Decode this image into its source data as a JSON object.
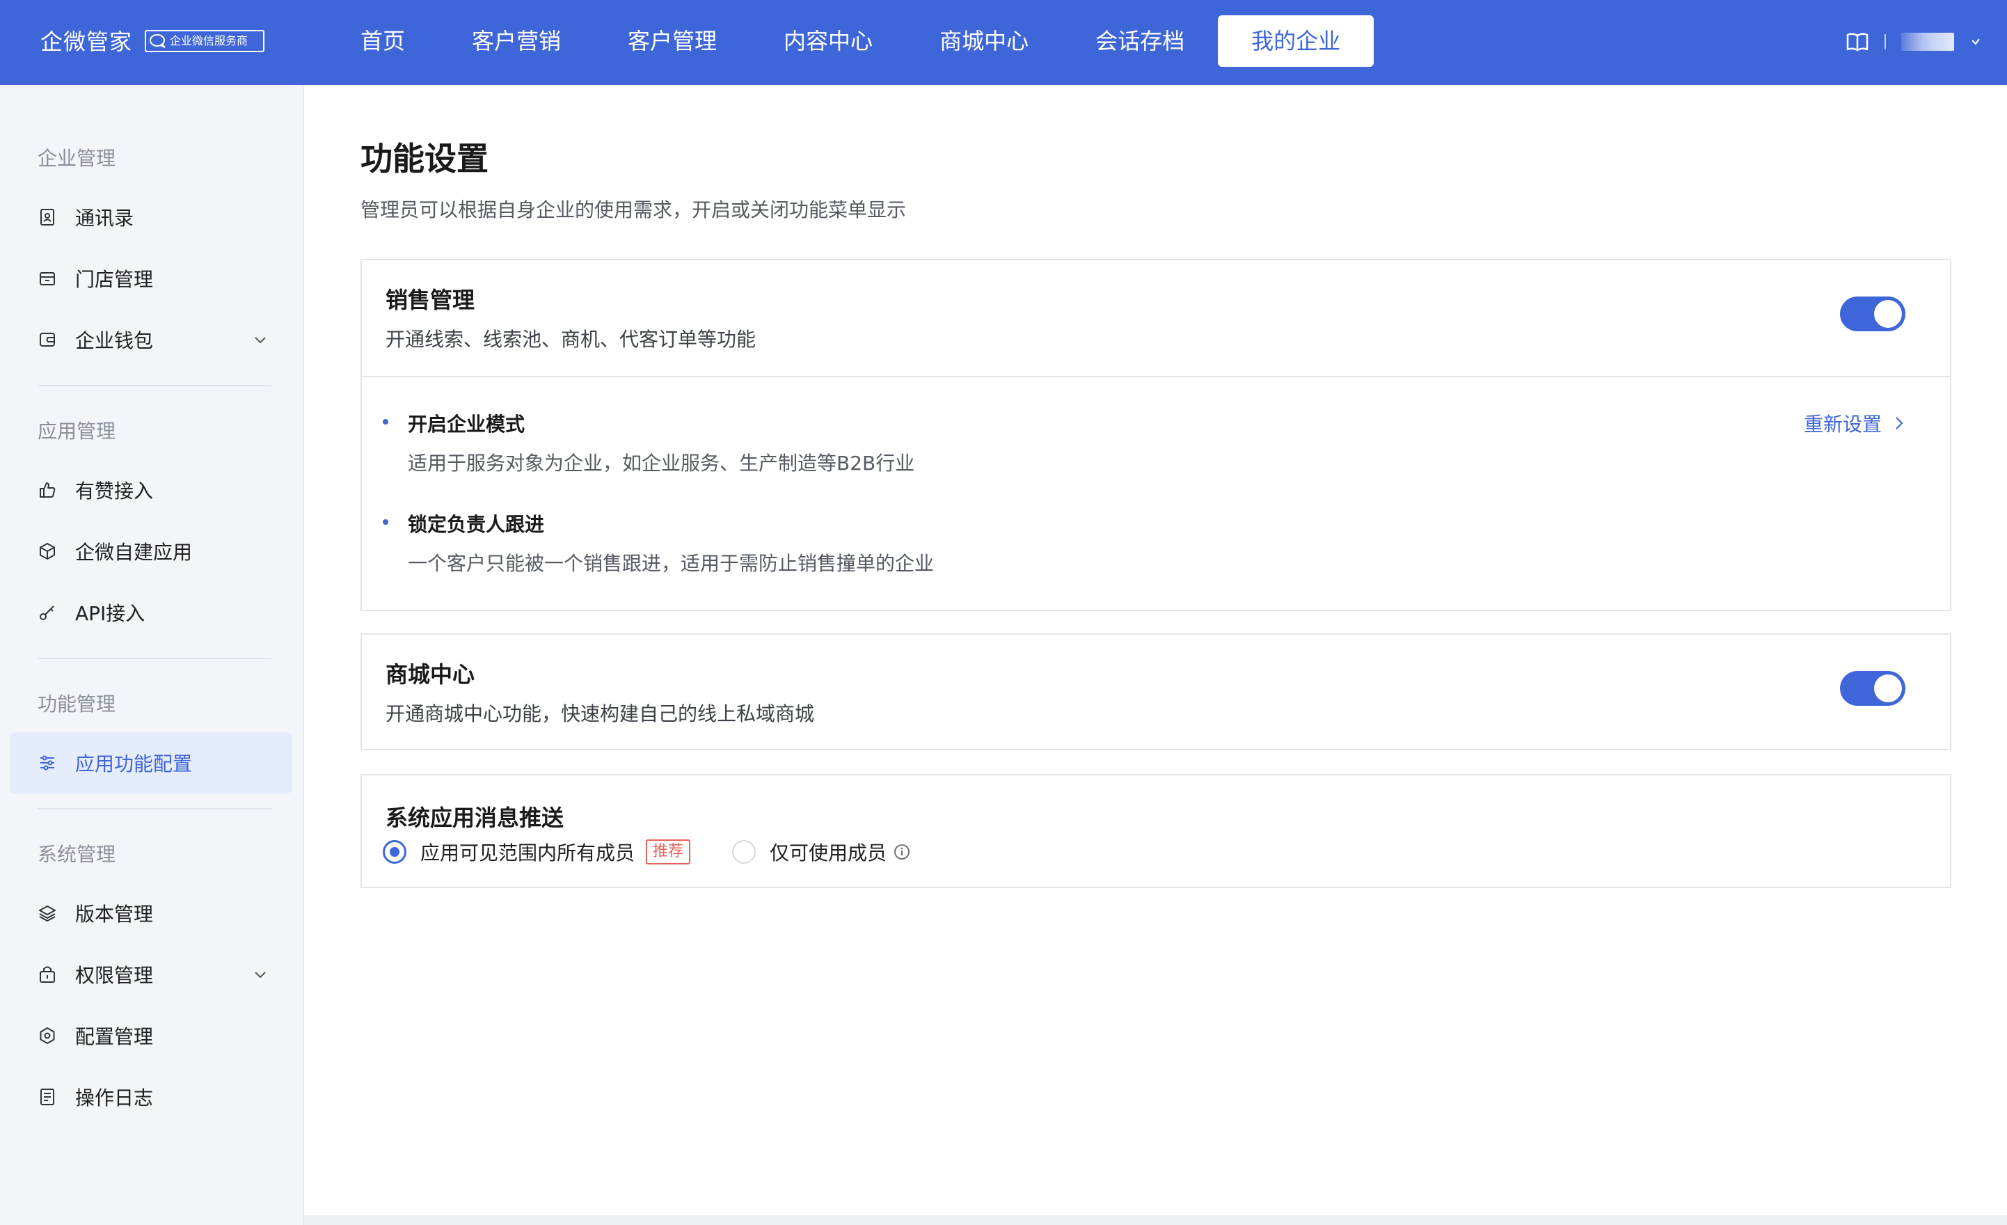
{
  "header": {
    "brand": "企微管家",
    "badge": "企业微信服务商",
    "nav": [
      {
        "label": "首页",
        "active": false
      },
      {
        "label": "客户营销",
        "active": false
      },
      {
        "label": "客户管理",
        "active": false
      },
      {
        "label": "内容中心",
        "active": false
      },
      {
        "label": "商城中心",
        "active": false
      },
      {
        "label": "会话存档",
        "active": false
      },
      {
        "label": "我的企业",
        "active": true
      }
    ],
    "right_icons": [
      "book-icon",
      "chevron-down-icon"
    ]
  },
  "sidebar": {
    "groups": [
      {
        "title": "企业管理",
        "items": [
          {
            "label": "通讯录",
            "icon": "contacts-icon"
          },
          {
            "label": "门店管理",
            "icon": "store-icon"
          },
          {
            "label": "企业钱包",
            "icon": "wallet-icon",
            "expandable": true
          }
        ]
      },
      {
        "title": "应用管理",
        "items": [
          {
            "label": "有赞接入",
            "icon": "thumbs-up-icon"
          },
          {
            "label": "企微自建应用",
            "icon": "cube-icon"
          },
          {
            "label": "API接入",
            "icon": "key-icon"
          }
        ]
      },
      {
        "title": "功能管理",
        "items": [
          {
            "label": "应用功能配置",
            "icon": "sliders-icon",
            "active": true
          }
        ]
      },
      {
        "title": "系统管理",
        "items": [
          {
            "label": "版本管理",
            "icon": "layers-icon"
          },
          {
            "label": "权限管理",
            "icon": "lock-icon",
            "expandable": true
          },
          {
            "label": "配置管理",
            "icon": "settings-icon"
          },
          {
            "label": "操作日志",
            "icon": "log-icon"
          }
        ]
      }
    ]
  },
  "main": {
    "title": "功能设置",
    "desc": "管理员可以根据自身企业的使用需求，开启或关闭功能菜单显示",
    "sales": {
      "title": "销售管理",
      "desc": "开通线索、线索池、商机、代客订单等功能",
      "enabled": true,
      "reset_label": "重新设置",
      "options": [
        {
          "title": "开启企业模式",
          "desc": "适用于服务对象为企业，如企业服务、生产制造等B2B行业"
        },
        {
          "title": "锁定负责人跟进",
          "desc": "一个客户只能被一个销售跟进，适用于需防止销售撞单的企业"
        }
      ]
    },
    "mall": {
      "title": "商城中心",
      "desc": "开通商城中心功能，快速构建自己的线上私域商城",
      "enabled": true
    },
    "push": {
      "title": "系统应用消息推送",
      "options": [
        {
          "label": "应用可见范围内所有成员",
          "checked": true,
          "tag": "推荐"
        },
        {
          "label": "仅可使用成员",
          "checked": false
        }
      ]
    }
  },
  "colors": {
    "primary": "#3f66d8",
    "sidebar_bg": "#f3f5f9",
    "tag_red": "#e8605b"
  }
}
